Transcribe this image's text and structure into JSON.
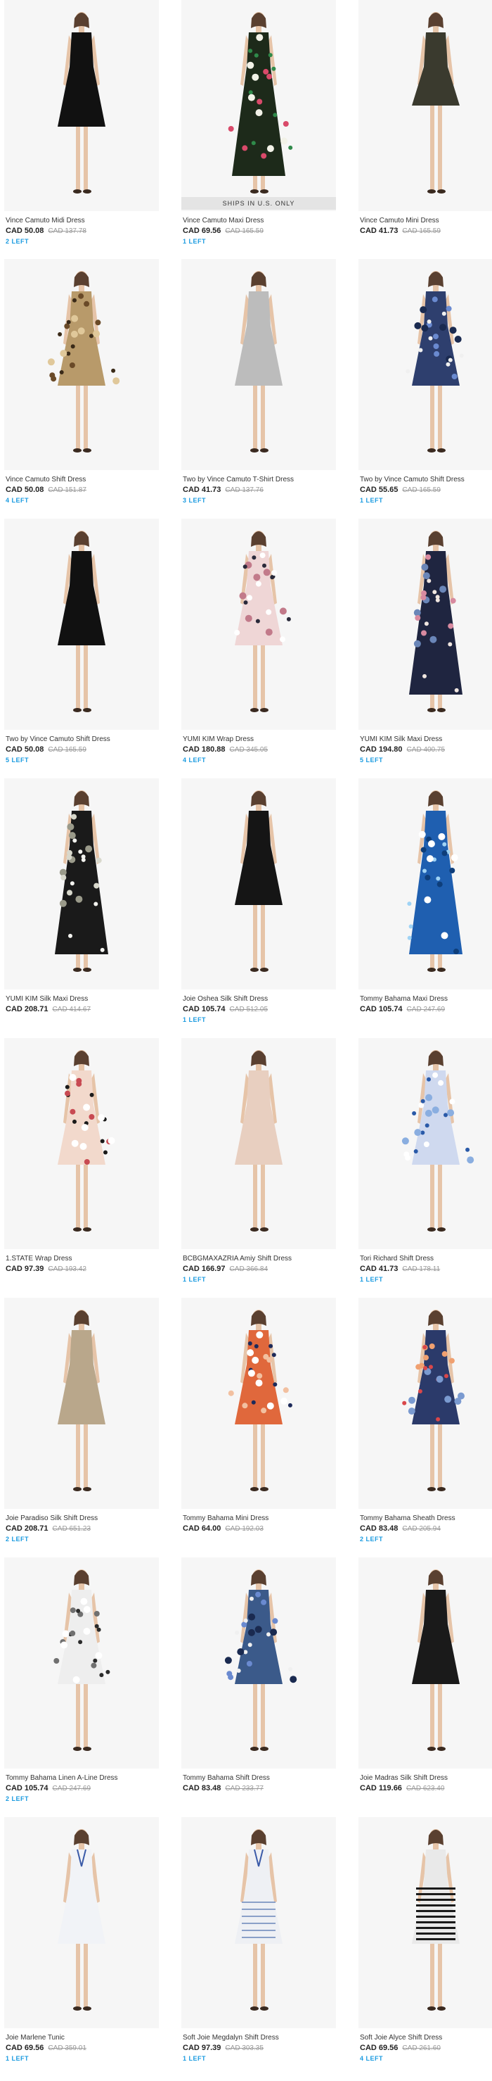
{
  "badge_text": "SHIPS IN U.S. ONLY",
  "colors": {
    "accent": "#1a9be0"
  },
  "products": [
    {
      "name": "Vince Camuto Midi Dress",
      "price": "CAD 50.08",
      "orig": "CAD 137.78",
      "left": "2 LEFT",
      "dress": "#111111",
      "pattern": "solid"
    },
    {
      "name": "Vince Camuto Maxi Dress",
      "price": "CAD 69.56",
      "orig": "CAD 165.59",
      "left": "1 LEFT",
      "dress": "#1d2a1a",
      "pattern": "floral-green",
      "badge": true
    },
    {
      "name": "Vince Camuto Mini Dress",
      "price": "CAD 41.73",
      "orig": "CAD 165.59",
      "left": "",
      "dress": "#3a3a2e",
      "pattern": "solid"
    },
    {
      "name": "Vince Camuto Shift Dress",
      "price": "CAD 50.08",
      "orig": "CAD 151.87",
      "left": "4 LEFT",
      "dress": "#b89a6a",
      "pattern": "leopard"
    },
    {
      "name": "Two by Vince Camuto T-Shirt Dress",
      "price": "CAD 41.73",
      "orig": "CAD 137.76",
      "left": "3 LEFT",
      "dress": "#bcbcbc",
      "pattern": "solid"
    },
    {
      "name": "Two by Vince Camuto Shift Dress",
      "price": "CAD 55.65",
      "orig": "CAD 165.59",
      "left": "1 LEFT",
      "dress": "#2e3f6e",
      "pattern": "print-blue"
    },
    {
      "name": "Two by Vince Camuto Shift Dress",
      "price": "CAD 50.08",
      "orig": "CAD 165.59",
      "left": "5 LEFT",
      "dress": "#111111",
      "pattern": "solid"
    },
    {
      "name": "YUMI KIM Wrap Dress",
      "price": "CAD 180.88",
      "orig": "CAD 345.05",
      "left": "4 LEFT",
      "dress": "#efd6d6",
      "pattern": "floral-pink"
    },
    {
      "name": "YUMI KIM Silk Maxi Dress",
      "price": "CAD 194.80",
      "orig": "CAD 400.75",
      "left": "5 LEFT",
      "dress": "#1f2540",
      "pattern": "floral-navy"
    },
    {
      "name": "YUMI KIM Silk Maxi Dress",
      "price": "CAD 208.71",
      "orig": "CAD 414.67",
      "left": "",
      "dress": "#1a1a1a",
      "pattern": "floral-white"
    },
    {
      "name": "Joie Oshea Silk Shift Dress",
      "price": "CAD 105.74",
      "orig": "CAD 512.05",
      "left": "1 LEFT",
      "dress": "#151515",
      "pattern": "solid"
    },
    {
      "name": "Tommy Bahama Maxi Dress",
      "price": "CAD 105.74",
      "orig": "CAD 247.69",
      "left": "",
      "dress": "#1f5fb0",
      "pattern": "floral-blue"
    },
    {
      "name": "1.STATE Wrap Dress",
      "price": "CAD 97.39",
      "orig": "CAD 193.42",
      "left": "",
      "dress": "#f2d9cc",
      "pattern": "floral-black"
    },
    {
      "name": "BCBGMAXAZRIA Amiy Shift Dress",
      "price": "CAD 166.97",
      "orig": "CAD 366.84",
      "left": "1 LEFT",
      "dress": "#e8cfc0",
      "pattern": "solid"
    },
    {
      "name": "Tori Richard Shift Dress",
      "price": "CAD 41.73",
      "orig": "CAD 178.11",
      "left": "1 LEFT",
      "dress": "#cfd9ef",
      "pattern": "tile-blue"
    },
    {
      "name": "Joie Paradiso Silk Shift Dress",
      "price": "CAD 208.71",
      "orig": "CAD 651.23",
      "left": "2 LEFT",
      "dress": "#b9a78b",
      "pattern": "solid"
    },
    {
      "name": "Tommy Bahama Mini Dress",
      "price": "CAD 64.00",
      "orig": "CAD 192.03",
      "left": "",
      "dress": "#e0683c",
      "pattern": "print-orange"
    },
    {
      "name": "Tommy Bahama Sheath Dress",
      "price": "CAD 83.48",
      "orig": "CAD 205.94",
      "left": "2 LEFT",
      "dress": "#2b3a6a",
      "pattern": "floral-red"
    },
    {
      "name": "Tommy Bahama Linen A-Line Dress",
      "price": "CAD 105.74",
      "orig": "CAD 247.69",
      "left": "2 LEFT",
      "dress": "#eeeeee",
      "pattern": "floral-gray"
    },
    {
      "name": "Tommy Bahama Shift Dress",
      "price": "CAD 83.48",
      "orig": "CAD 233.77",
      "left": "",
      "dress": "#3b5a8a",
      "pattern": "print-blue"
    },
    {
      "name": "Joie Madras Silk Shift Dress",
      "price": "CAD 119.66",
      "orig": "CAD 623.40",
      "left": "",
      "dress": "#1a1a1a",
      "pattern": "solid"
    },
    {
      "name": "Joie Marlene Tunic",
      "price": "CAD 69.56",
      "orig": "CAD 359.01",
      "left": "1 LEFT",
      "dress": "#f1f3f7",
      "pattern": "tunic"
    },
    {
      "name": "Soft Joie Megdalyn Shift Dress",
      "price": "CAD 97.39",
      "orig": "CAD 303.35",
      "left": "1 LEFT",
      "dress": "#eef0f4",
      "pattern": "tunic-blue"
    },
    {
      "name": "Soft Joie Alyce Shift Dress",
      "price": "CAD 69.56",
      "orig": "CAD 261.60",
      "left": "4 LEFT",
      "dress": "#e9e9e9",
      "pattern": "stripe"
    }
  ]
}
